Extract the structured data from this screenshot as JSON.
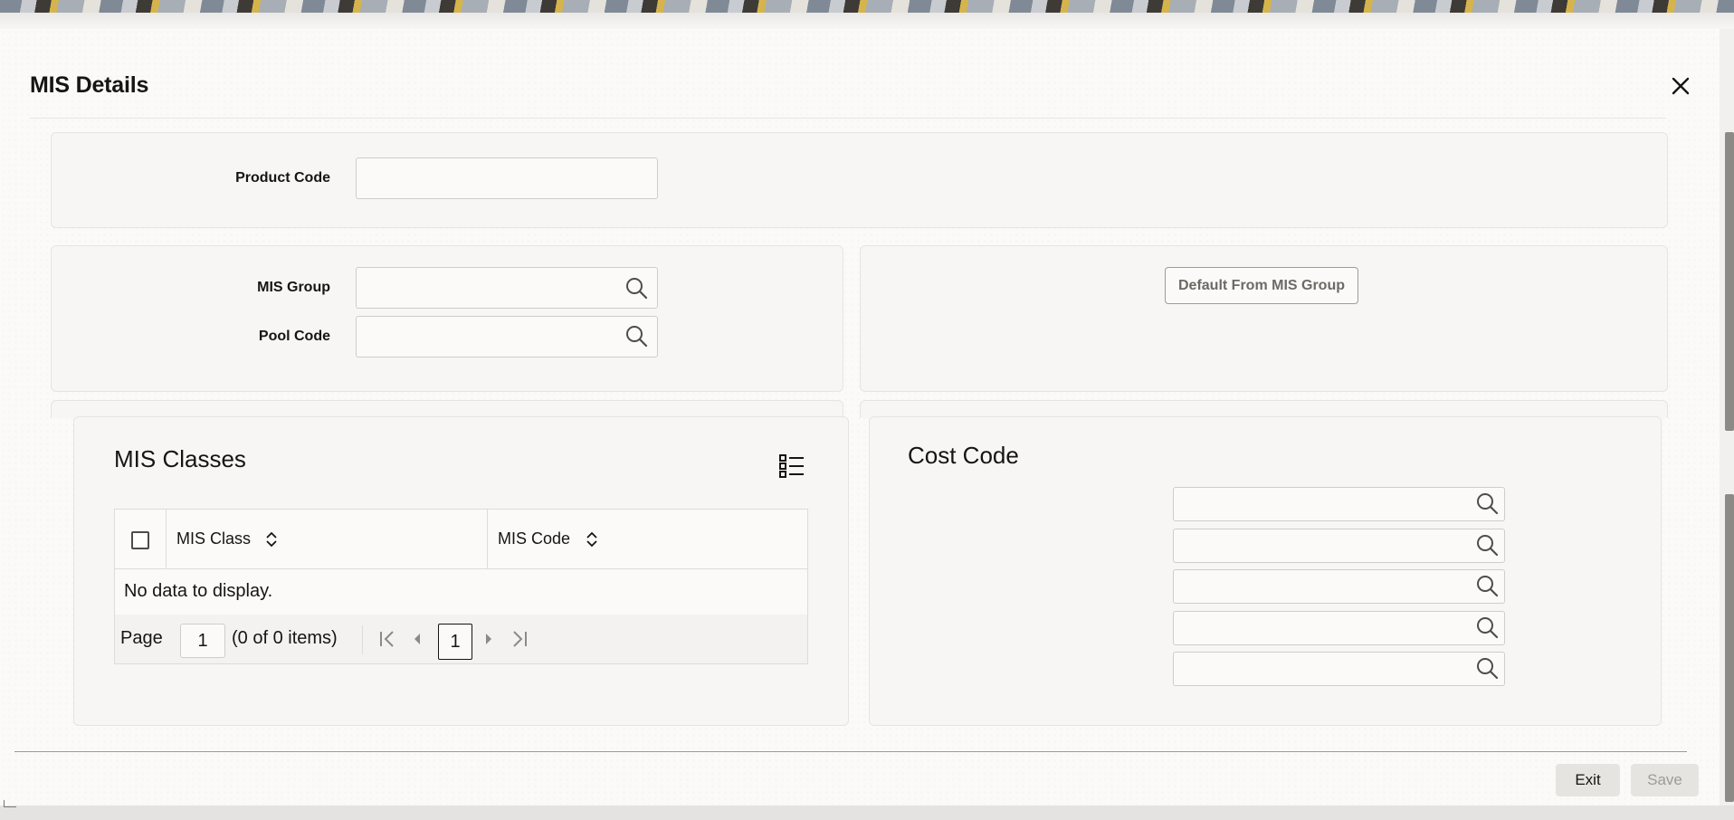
{
  "dialog": {
    "title": "MIS Details",
    "close_label": "Close"
  },
  "product": {
    "label": "Product Code",
    "value": ""
  },
  "mis_group_panel": {
    "mis_group_label": "MIS Group",
    "mis_group_value": "",
    "pool_code_label": "Pool Code",
    "pool_code_value": ""
  },
  "default_button": {
    "label": "Default From MIS Group"
  },
  "mis_classes": {
    "title": "MIS Classes",
    "columns": [
      "MIS Class",
      "MIS Code"
    ],
    "rows": [],
    "empty_message": "No data to display.",
    "pager": {
      "page_label": "Page",
      "page_value": "1",
      "summary": "(0 of 0 items)",
      "current_page": "1"
    }
  },
  "cost_code": {
    "title": "Cost Code",
    "fields": [
      "",
      "",
      "",
      "",
      ""
    ]
  },
  "footer": {
    "exit_label": "Exit",
    "save_label": "Save"
  },
  "colors": {
    "text": "#161513",
    "panel_bg": "#f7f6f4",
    "border": "#cfcdc9",
    "disabled_text": "#9e9c98"
  }
}
